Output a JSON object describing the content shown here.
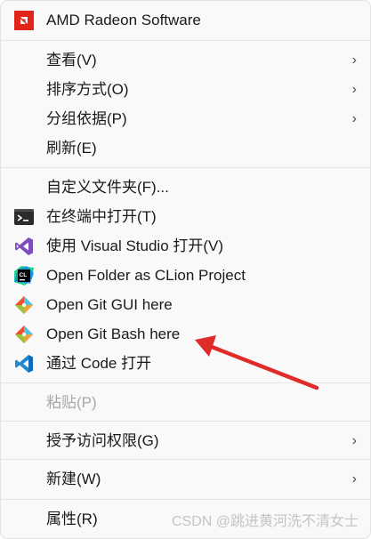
{
  "menu": {
    "amd": "AMD Radeon Software",
    "view": "查看(V)",
    "sort": "排序方式(O)",
    "group": "分组依据(P)",
    "refresh": "刷新(E)",
    "customize": "自定义文件夹(F)...",
    "terminal": "在终端中打开(T)",
    "visual_studio": "使用 Visual Studio 打开(V)",
    "clion": "Open Folder as CLion Project",
    "git_gui": "Open Git GUI here",
    "git_bash": "Open Git Bash here",
    "vscode": "通过 Code 打开",
    "paste": "粘贴(P)",
    "access": "授予访问权限(G)",
    "new": "新建(W)",
    "properties": "属性(R)"
  },
  "chevron": "›",
  "watermark": "CSDN @跳进黄河洗不清女士",
  "colors": {
    "amd_red": "#e1251b",
    "arrow_red": "#e02b2b",
    "vs_purple": "#7c4dbd",
    "vscode_blue": "#1f8ad2"
  },
  "icons": [
    "amd-logo-icon",
    "terminal-icon",
    "visual-studio-icon",
    "clion-icon",
    "git-gui-icon",
    "git-bash-icon",
    "vscode-icon"
  ]
}
